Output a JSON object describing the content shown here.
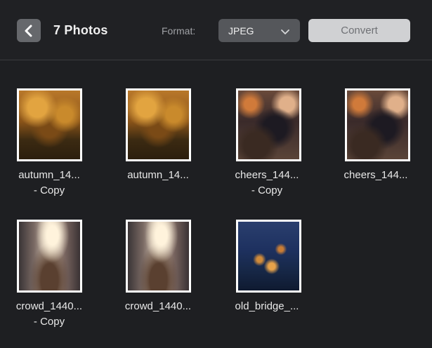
{
  "header": {
    "title": "7 Photos",
    "format_label": "Format:",
    "format_value": "JPEG",
    "convert_label": "Convert"
  },
  "icons": {
    "back": "chevron-left-icon",
    "format_dropdown": "chevron-down-icon"
  },
  "colors": {
    "background": "#1e1f22",
    "back_button": "#66686c",
    "select_bg": "#55575b",
    "convert_bg": "#d0d1d3",
    "convert_text": "#6f7175"
  },
  "photos": [
    {
      "name_line1": "autumn_14...",
      "name_line2": "- Copy",
      "image": "autumn forest scene"
    },
    {
      "name_line1": "autumn_14...",
      "name_line2": "",
      "image": "autumn forest scene"
    },
    {
      "name_line1": "cheers_144...",
      "name_line2": "- Copy",
      "image": "night street crowd"
    },
    {
      "name_line1": "cheers_144...",
      "name_line2": "",
      "image": "night street crowd"
    },
    {
      "name_line1": "crowd_1440...",
      "name_line2": "- Copy",
      "image": "sunlit city street"
    },
    {
      "name_line1": "crowd_1440...",
      "name_line2": "",
      "image": "sunlit city street"
    },
    {
      "name_line1": "old_bridge_...",
      "name_line2": "",
      "image": "city at night aerial"
    }
  ]
}
